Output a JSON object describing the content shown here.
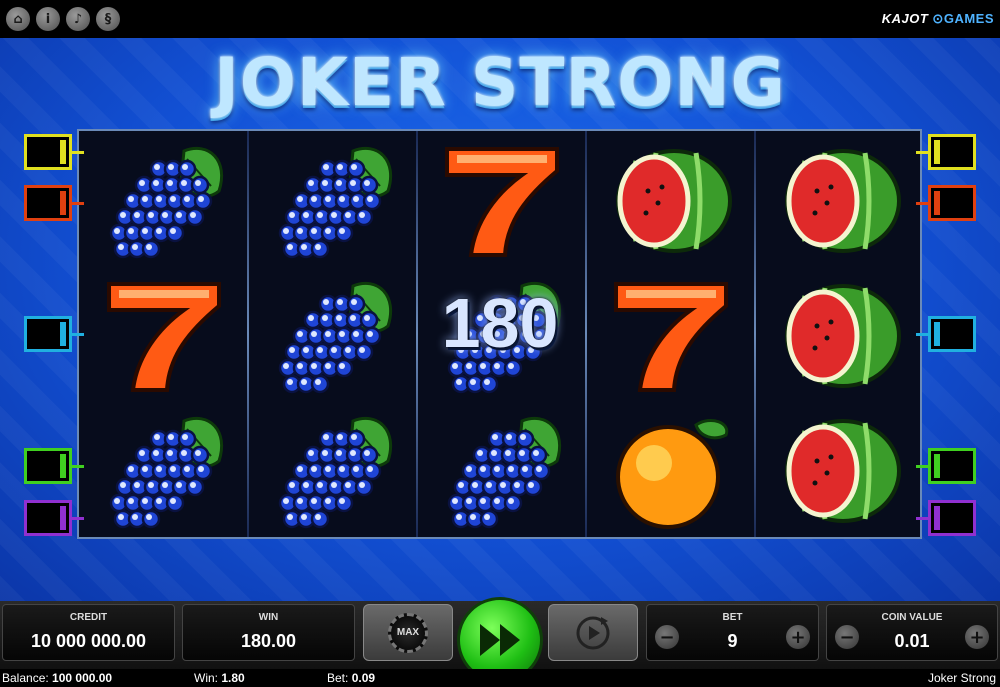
{
  "topbar": {
    "buttons": [
      {
        "name": "home-icon",
        "glyph": "⌂"
      },
      {
        "name": "info-icon",
        "glyph": "i"
      },
      {
        "name": "sound-icon",
        "glyph": "♪"
      },
      {
        "name": "rules-icon",
        "glyph": "§"
      }
    ],
    "brand_main": "KAJOT",
    "brand_games": "GAMES"
  },
  "game": {
    "title": "JOKER STRONG",
    "win_amount": "180"
  },
  "reels": [
    [
      "grapes",
      "seven",
      "grapes"
    ],
    [
      "grapes",
      "grapes",
      "grapes"
    ],
    [
      "seven",
      "grapes",
      "grapes"
    ],
    [
      "melon",
      "seven",
      "orange"
    ],
    [
      "melon",
      "melon",
      "melon"
    ]
  ],
  "paylines": [
    {
      "color": "#e0e020"
    },
    {
      "color": "#e04010"
    },
    {
      "color": "#20b0e0"
    },
    {
      "color": "#40d020"
    },
    {
      "color": "#9030d0"
    }
  ],
  "controls": {
    "credit_label": "CREDIT",
    "credit_value": "10 000 000.00",
    "win_label": "WIN",
    "win_value": "180.00",
    "max_label": "MAX",
    "bet_label": "BET",
    "bet_value": "9",
    "coin_label": "COIN VALUE",
    "coin_value": "0.01",
    "minus": "−",
    "plus": "+"
  },
  "status": {
    "balance_label": "Balance:",
    "balance_value": "100 000.00",
    "win_label": "Win:",
    "win_value": "1.80",
    "bet_label": "Bet:",
    "bet_value": "0.09",
    "game_name": "Joker Strong"
  }
}
